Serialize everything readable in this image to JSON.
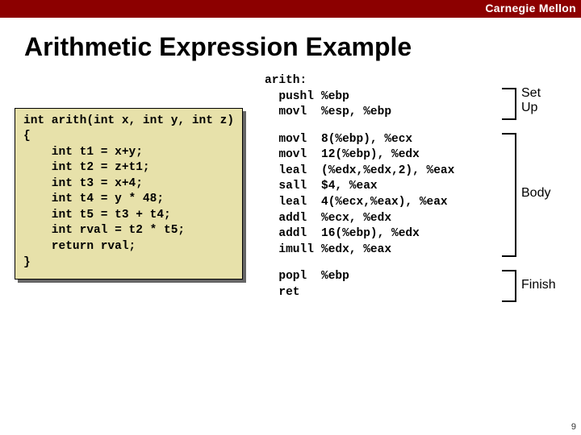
{
  "brand": "Carnegie Mellon",
  "title": "Arithmetic Expression Example",
  "page_number": "9",
  "c_code": "int arith(int x, int y, int z)\n{\n    int t1 = x+y;\n    int t2 = z+t1;\n    int t3 = x+4;\n    int t4 = y * 48;\n    int t5 = t3 + t4;\n    int rval = t2 * t5;\n    return rval;\n}",
  "asm": {
    "label": "arith:",
    "setup": [
      {
        "op": "pushl",
        "args": "%ebp"
      },
      {
        "op": "movl",
        "args": "%esp, %ebp"
      }
    ],
    "body": [
      {
        "op": "movl",
        "args": "8(%ebp), %ecx"
      },
      {
        "op": "movl",
        "args": "12(%ebp), %edx"
      },
      {
        "op": "leal",
        "args": "(%edx,%edx,2), %eax"
      },
      {
        "op": "sall",
        "args": "$4, %eax"
      },
      {
        "op": "leal",
        "args": "4(%ecx,%eax), %eax"
      },
      {
        "op": "addl",
        "args": "%ecx, %edx"
      },
      {
        "op": "addl",
        "args": "16(%ebp), %edx"
      },
      {
        "op": "imull",
        "args": "%edx, %eax"
      }
    ],
    "finish": [
      {
        "op": "popl",
        "args": "%ebp"
      },
      {
        "op": "ret",
        "args": ""
      }
    ]
  },
  "labels": {
    "setup": "Set\nUp",
    "body": "Body",
    "finish": "Finish"
  }
}
